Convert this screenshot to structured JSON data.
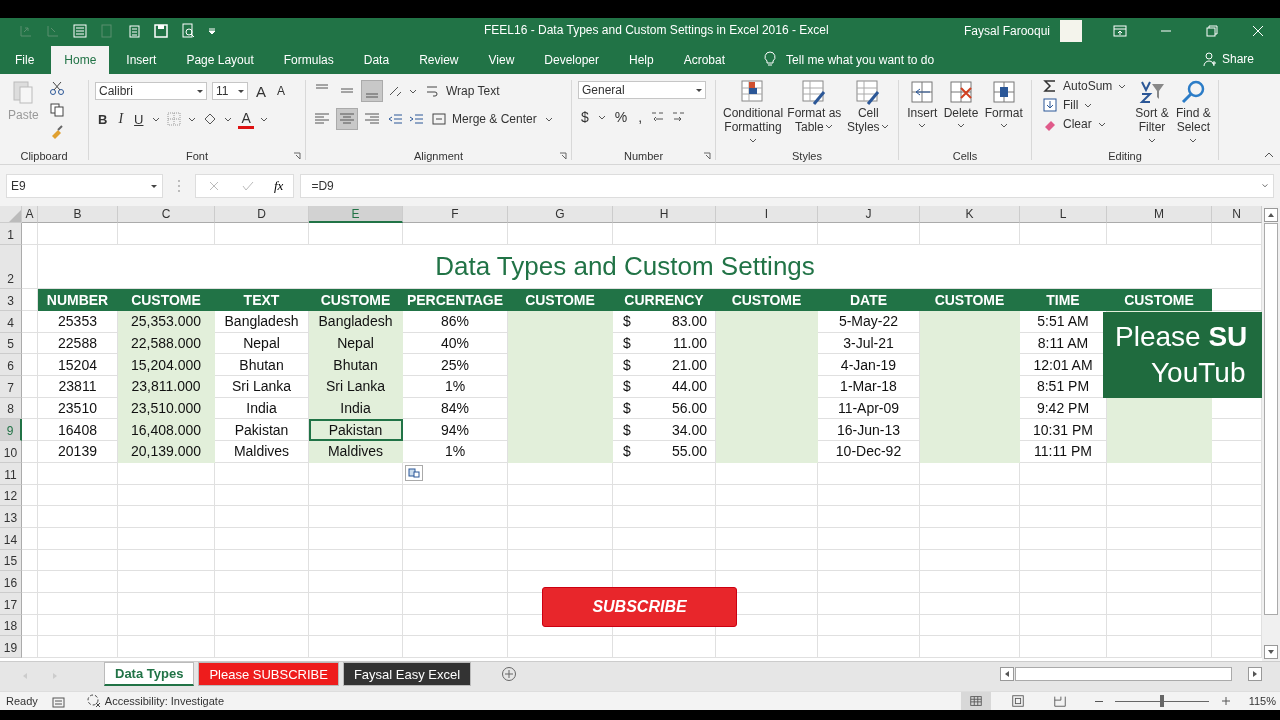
{
  "window": {
    "title": "FEEL16 - Data Types and Custom Settings in Excel 2016  -  Excel",
    "user": "Faysal Farooqui"
  },
  "ribbon_tabs": [
    {
      "label": "File",
      "selected": false
    },
    {
      "label": "Home",
      "selected": true
    },
    {
      "label": "Insert",
      "selected": false
    },
    {
      "label": "Page Layout",
      "selected": false
    },
    {
      "label": "Formulas",
      "selected": false
    },
    {
      "label": "Data",
      "selected": false
    },
    {
      "label": "Review",
      "selected": false
    },
    {
      "label": "View",
      "selected": false
    },
    {
      "label": "Developer",
      "selected": false
    },
    {
      "label": "Help",
      "selected": false
    },
    {
      "label": "Acrobat",
      "selected": false
    }
  ],
  "tell_me": "Tell me what you want to do",
  "share": "Share",
  "ribbon": {
    "clipboard": {
      "label": "Clipboard",
      "paste": "Paste"
    },
    "font": {
      "label": "Font",
      "font_name": "Calibri",
      "font_size": "11",
      "grow": "A",
      "shrink": "A",
      "bold": "B",
      "italic": "I",
      "underline": "U",
      "font_color": "A"
    },
    "alignment": {
      "label": "Alignment",
      "wrap_text": "Wrap Text",
      "merge_center": "Merge & Center",
      "vertical_align": [
        {
          "selected": false
        },
        {
          "selected": false
        },
        {
          "selected": true
        }
      ],
      "horizontal_align": [
        {
          "selected": false
        },
        {
          "selected": true
        },
        {
          "selected": false
        }
      ]
    },
    "number": {
      "label": "Number",
      "format": "General",
      "currency": "$",
      "percent": "%",
      "comma": ","
    },
    "styles": {
      "label": "Styles",
      "buttons": [
        "Conditional Formatting",
        "Format as Table",
        "Cell Styles"
      ]
    },
    "cells": {
      "label": "Cells",
      "buttons": [
        "Insert",
        "Delete",
        "Format"
      ]
    },
    "editing": {
      "label": "Editing",
      "autosum": "AutoSum",
      "fill": "Fill",
      "clear": "Clear",
      "buttons": [
        "Sort & Filter",
        "Find & Select"
      ]
    }
  },
  "formula_bar": {
    "name_box": "E9",
    "fx": "fx",
    "formula": "=D9"
  },
  "columns": [
    {
      "label": "A",
      "selected": false
    },
    {
      "label": "B",
      "selected": false
    },
    {
      "label": "C",
      "selected": false
    },
    {
      "label": "D",
      "selected": false
    },
    {
      "label": "E",
      "selected": true
    },
    {
      "label": "F",
      "selected": false
    },
    {
      "label": "G",
      "selected": false
    },
    {
      "label": "H",
      "selected": false
    },
    {
      "label": "I",
      "selected": false
    },
    {
      "label": "J",
      "selected": false
    },
    {
      "label": "K",
      "selected": false
    },
    {
      "label": "L",
      "selected": false
    },
    {
      "label": "M",
      "selected": false
    },
    {
      "label": "N",
      "selected": false
    }
  ],
  "row_headers": [
    {
      "label": "1",
      "selected": false
    },
    {
      "label": "2",
      "selected": false
    },
    {
      "label": "3",
      "selected": false
    },
    {
      "label": "4",
      "selected": false
    },
    {
      "label": "5",
      "selected": false
    },
    {
      "label": "6",
      "selected": false
    },
    {
      "label": "7",
      "selected": false
    },
    {
      "label": "8",
      "selected": false
    },
    {
      "label": "9",
      "selected": true
    },
    {
      "label": "10",
      "selected": false
    },
    {
      "label": "11",
      "selected": false
    },
    {
      "label": "12",
      "selected": false
    },
    {
      "label": "13",
      "selected": false
    },
    {
      "label": "14",
      "selected": false
    },
    {
      "label": "15",
      "selected": false
    },
    {
      "label": "16",
      "selected": false
    },
    {
      "label": "17",
      "selected": false
    },
    {
      "label": "18",
      "selected": false
    },
    {
      "label": "19",
      "selected": false
    }
  ],
  "sheet": {
    "title": "Data Types and Custom Settings",
    "headers": [
      {
        "label": "NUMBER",
        "kind": "plain"
      },
      {
        "label": "CUSTOME",
        "kind": "custom"
      },
      {
        "label": "TEXT",
        "kind": "plain"
      },
      {
        "label": "CUSTOME",
        "kind": "custom"
      },
      {
        "label": "PERCENTAGE",
        "kind": "plain"
      },
      {
        "label": "CUSTOME",
        "kind": "custom"
      },
      {
        "label": "CURRENCY",
        "kind": "currency"
      },
      {
        "label": "CUSTOME",
        "kind": "custom"
      },
      {
        "label": "DATE",
        "kind": "plain"
      },
      {
        "label": "CUSTOME",
        "kind": "custom"
      },
      {
        "label": "TIME",
        "kind": "plain"
      },
      {
        "label": "CUSTOME",
        "kind": "custom"
      }
    ],
    "rows": [
      [
        "25353",
        "25,353.000",
        "Bangladesh",
        "Bangladesh",
        "86%",
        null,
        {
          "symbol": "$",
          "amount": "83.00"
        },
        null,
        "5-May-22",
        null,
        "5:51 AM",
        null
      ],
      [
        "22588",
        "22,588.000",
        "Nepal",
        "Nepal",
        "40%",
        null,
        {
          "symbol": "$",
          "amount": "11.00"
        },
        null,
        "3-Jul-21",
        null,
        "8:11 AM",
        null
      ],
      [
        "15204",
        "15,204.000",
        "Bhutan",
        "Bhutan",
        "25%",
        null,
        {
          "symbol": "$",
          "amount": "21.00"
        },
        null,
        "4-Jan-19",
        null,
        "12:01 AM",
        null
      ],
      [
        "23811",
        "23,811.000",
        "Sri Lanka",
        "Sri Lanka",
        "1%",
        null,
        {
          "symbol": "$",
          "amount": "44.00"
        },
        null,
        "1-Mar-18",
        null,
        "8:51 PM",
        null
      ],
      [
        "23510",
        "23,510.000",
        "India",
        "India",
        "84%",
        null,
        {
          "symbol": "$",
          "amount": "56.00"
        },
        null,
        "11-Apr-09",
        null,
        "9:42 PM",
        null
      ],
      [
        "16408",
        "16,408.000",
        "Pakistan",
        "Pakistan",
        "94%",
        null,
        {
          "symbol": "$",
          "amount": "34.00"
        },
        null,
        "16-Jun-13",
        null,
        "10:31 PM",
        null
      ],
      [
        "20139",
        "20,139.000",
        "Maldives",
        "Maldives",
        "1%",
        null,
        {
          "symbol": "$",
          "amount": "55.00"
        },
        null,
        "10-Dec-92",
        null,
        "11:11 PM",
        null
      ]
    ]
  },
  "sheet_tabs": [
    {
      "label": "Data Types",
      "selected": true,
      "color": "#ffffff"
    },
    {
      "label": "Please SUBSCRIBE",
      "selected": false,
      "color": "#ee1c1c"
    },
    {
      "label": "Faysal Easy Excel",
      "selected": false,
      "color": "#333333"
    }
  ],
  "status_bar": {
    "ready": "Ready",
    "accessibility": "Accessibility: Investigate",
    "zoom": "115%",
    "zoom_slider": {
      "level": 0.5
    }
  },
  "overlays": {
    "banner": [
      "Please **SU**",
      "YouTub"
    ],
    "subscribe": "SUBSCRIBE"
  }
}
